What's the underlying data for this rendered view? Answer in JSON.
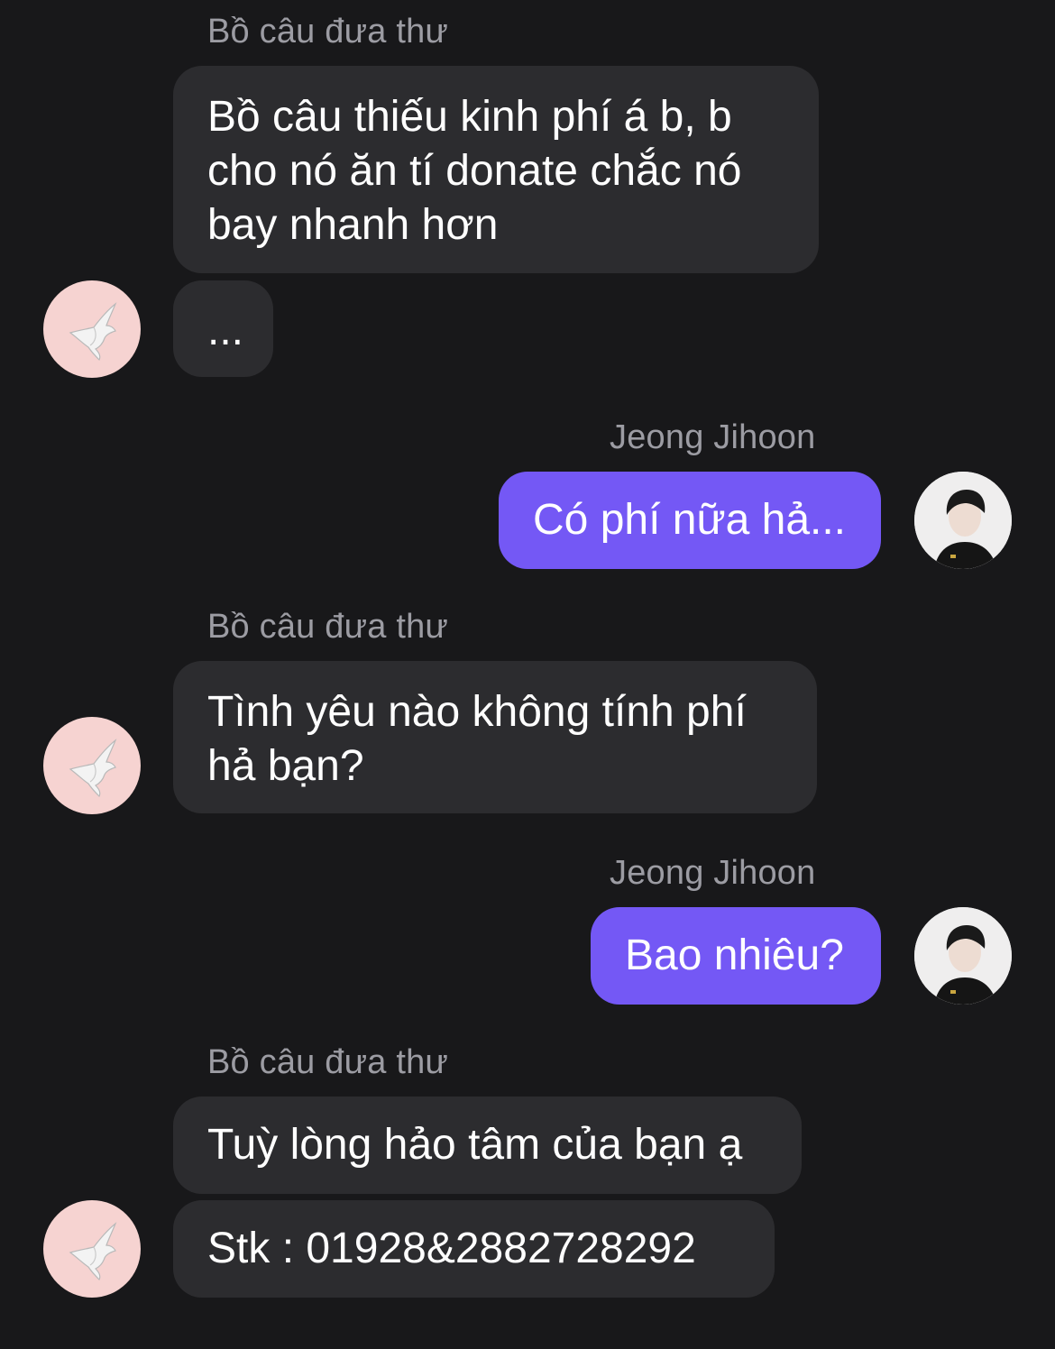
{
  "conversation": {
    "messages": [
      {
        "sender": "Bồ câu đưa thư",
        "text": "Bồ câu thiếu kinh phí á b, b\ncho nó ăn tí donate chắc nó\nbay nhanh hơn"
      },
      {
        "text": "..."
      },
      {
        "sender": "Jeong Jihoon",
        "text": "Có phí nữa hả..."
      },
      {
        "sender": "Bồ câu đưa thư",
        "text": "Tình yêu nào không tính phí\nhả bạn?"
      },
      {
        "sender": "Jeong Jihoon",
        "text": "Bao nhiêu?"
      },
      {
        "sender": "Bồ câu đưa thư",
        "text": "Tuỳ lòng hảo tâm của bạn ạ"
      },
      {
        "text": "Stk : 01928&2882728292"
      }
    ]
  },
  "avatars": {
    "bot_icon": "dove-icon",
    "user_icon": "user-photo"
  },
  "colors": {
    "background": "#18181a",
    "incoming_bubble": "#2c2c2f",
    "outgoing_bubble": "#7458f5",
    "sender_name": "#9c9ca3",
    "bot_avatar_bg": "#f6d3d1"
  }
}
